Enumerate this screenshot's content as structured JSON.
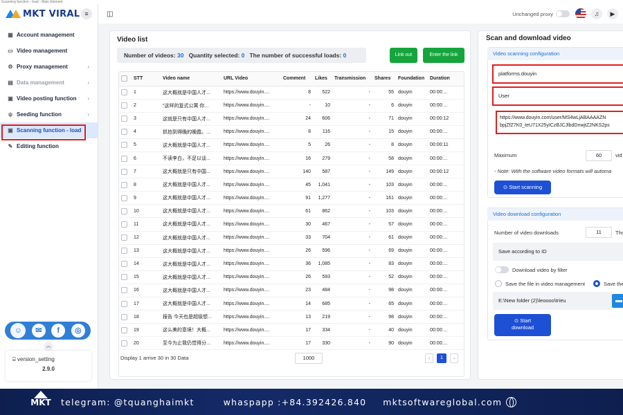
{
  "window": {
    "title": "Scanning function - load - Main Element"
  },
  "brand": {
    "name": "MKT VIRAL"
  },
  "sidebar": {
    "items": [
      {
        "label": "Account management",
        "icon": "grid-icon"
      },
      {
        "label": "Video management",
        "icon": "video-icon"
      },
      {
        "label": "Proxy management",
        "icon": "gear-icon"
      },
      {
        "label": "Data management",
        "icon": "database-icon"
      },
      {
        "label": "Video posting function",
        "icon": "upload-icon"
      },
      {
        "label": "Seeding function",
        "icon": "seed-icon"
      },
      {
        "label": "Scanning function - load",
        "icon": "scan-icon"
      },
      {
        "label": "Editing function",
        "icon": "pencil-icon"
      }
    ],
    "version_label": "version_setting",
    "version_number": "2.9.0"
  },
  "topbar": {
    "proxy_label": "Unchanged proxy"
  },
  "video_list": {
    "title": "Video list",
    "stats": {
      "videos_label": "Number of videos:",
      "videos_value": "30",
      "selected_label": "Quantity selected:",
      "selected_value": "0",
      "loads_label": "The number of successful loads:",
      "loads_value": "0"
    },
    "link_out_label": "Link out",
    "enter_link_label": "Enter the link",
    "columns": [
      "",
      "STT",
      "Video name",
      "URL Video",
      "Comment",
      "Likes",
      "Transmission",
      "Shares",
      "Foundation",
      "Duration"
    ],
    "rows": [
      [
        "1",
        "这大概就是中国人才...",
        "https://www.douyin....",
        "8",
        "522",
        "-",
        "55",
        "douyin",
        "00:00:..."
      ],
      [
        "2",
        "\"这样的复式公寓 你...",
        "https://www.douyin....",
        "-",
        "10",
        "-",
        "6",
        "douyin",
        "00:00:..."
      ],
      [
        "3",
        "这就是只有中国人才...",
        "https://www.douyin....",
        "24",
        "606",
        "-",
        "71",
        "douyin",
        "00:00:12"
      ],
      [
        "4",
        "抓拍到得晚的晚霞。...",
        "https://www.douyin....",
        "8",
        "116",
        "-",
        "15",
        "douyin",
        "00:00:..."
      ],
      [
        "5",
        "这大概就是中国人才...",
        "https://www.douyin....",
        "5",
        "26",
        "-",
        "8",
        "douyin",
        "00:00:11"
      ],
      [
        "6",
        "不读李白，不足以谈...",
        "https://www.douyin....",
        "16",
        "279",
        "-",
        "58",
        "douyin",
        "00:00:..."
      ],
      [
        "7",
        "这大概就是只有中国...",
        "https://www.douyin....",
        "140",
        "587",
        "-",
        "149",
        "douyin",
        "00:00:12"
      ],
      [
        "8",
        "这大概就是中国人才...",
        "https://www.douyin....",
        "45",
        "1,041",
        "-",
        "103",
        "douyin",
        "00:00:..."
      ],
      [
        "9",
        "这大概就是中国人才...",
        "https://www.douyin....",
        "91",
        "1,277",
        "-",
        "161",
        "douyin",
        "00:00:..."
      ],
      [
        "10",
        "这大概就是中国人才...",
        "https://www.douyin....",
        "61",
        "862",
        "-",
        "103",
        "douyin",
        "00:00:..."
      ],
      [
        "11",
        "这大概就是中国人才...",
        "https://www.douyin....",
        "30",
        "467",
        "-",
        "57",
        "douyin",
        "00:00:..."
      ],
      [
        "12",
        "这大概就是中国人才...",
        "https://www.douyin....",
        "33",
        "704",
        "-",
        "61",
        "douyin",
        "00:00:..."
      ],
      [
        "13",
        "这大概就是中国人才...",
        "https://www.douyin....",
        "26",
        "596",
        "-",
        "69",
        "douyin",
        "00:00:..."
      ],
      [
        "14",
        "这大概就是中国人才...",
        "https://www.douyin....",
        "36",
        "1,085",
        "-",
        "83",
        "douyin",
        "00:00:..."
      ],
      [
        "15",
        "这大概就是中国人才...",
        "https://www.douyin....",
        "26",
        "593",
        "-",
        "52",
        "douyin",
        "00:00:..."
      ],
      [
        "16",
        "这大概就是中国人才...",
        "https://www.douyin....",
        "23",
        "484",
        "-",
        "98",
        "douyin",
        "00:00:..."
      ],
      [
        "17",
        "这大概就是中国人才...",
        "https://www.douyin....",
        "14",
        "685",
        "-",
        "65",
        "douyin",
        "00:00:..."
      ],
      [
        "18",
        "报告 今天也是超级想...",
        "https://www.douyin....",
        "13",
        "219",
        "-",
        "98",
        "douyin",
        "00:00:..."
      ],
      [
        "19",
        "这么美的意境！大概...",
        "https://www.douyin....",
        "17",
        "334",
        "-",
        "40",
        "douyin",
        "00:00:..."
      ],
      [
        "20",
        "至今为止我仍觉得分...",
        "https://www.douyin....",
        "17",
        "330",
        "-",
        "90",
        "douyin",
        "00:00:..."
      ]
    ],
    "footer_text": "Display 1 arrive 30 in 30 Data",
    "page_size": "1000",
    "current_page": "1",
    "prev_label": "‹",
    "next_label": "›"
  },
  "scan_panel": {
    "title": "Scan and download video",
    "scan_config_title": "Video scanning configuration",
    "platform_value": "platforms.douyin",
    "type_value": "User",
    "url_line1": "https://www.douyin.com/user/MS4wLjABAAAAZN",
    "url_line2": "bpjZfZ7K0_teU71X25yICzBJCJlbdDnwjtZ2NKS2ps",
    "maximum_label": "Maximum",
    "maximum_value": "60",
    "maximum_unit": "vid",
    "note": "- Note: With the software video formats will automa",
    "start_scan_label": "Start scanning",
    "download_config_title": "Video download configuration",
    "downloads_label": "Number of video downloads",
    "downloads_value": "11",
    "downloads_suffix": "Thr",
    "save_mode_value": "Save according to ID",
    "filter_label": "Download video by filter",
    "radio1_label": "Save the file in video management",
    "radio2_label": "Save the",
    "folder_path": "E:\\New folder (2)\\leoooo\\trieu",
    "start_download_label1": "Start",
    "start_download_label2": "download"
  },
  "banner": {
    "logo_text": "MKT",
    "telegram": "telegram: @tquanghaimkt",
    "whatsapp": "whaspapp :+84.392426.840",
    "website": "mktsoftwareglobal.com"
  },
  "colors": {
    "accent": "#1e50d6",
    "green": "#15a53c",
    "highlight": "#e01e1e",
    "banner": "#0e1f4f"
  }
}
